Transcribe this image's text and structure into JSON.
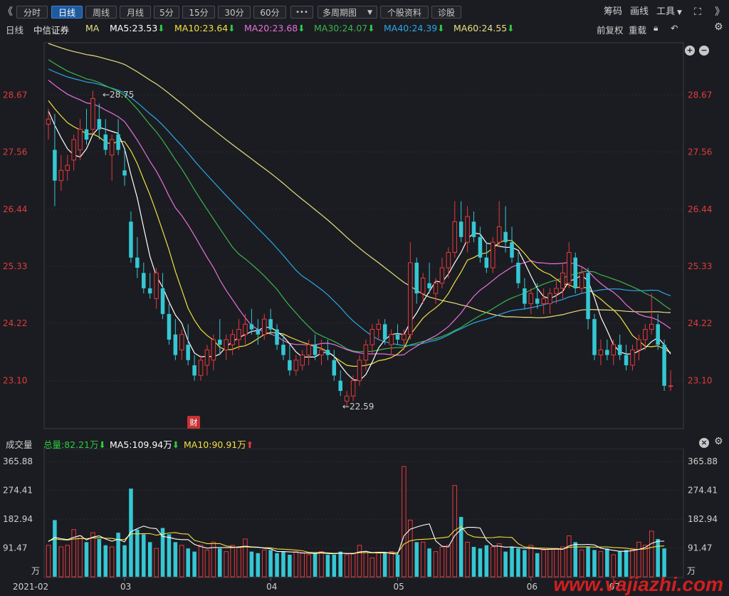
{
  "toolbar": {
    "prev": "《",
    "next": "》",
    "periods": [
      "分时",
      "日线",
      "周线",
      "月线",
      "5分",
      "15分",
      "30分",
      "60分"
    ],
    "active": "日线",
    "more": "•••",
    "multi_period": "多周期图",
    "stock_info": "个股资料",
    "diagnose": "诊股",
    "chips": "筹码",
    "draw": "画线",
    "tools": "工具"
  },
  "legend": {
    "period": "日线",
    "stock": "中信证券",
    "ma": "MA",
    "ma5": "MA5:23.53",
    "ma10": "MA10:23.64",
    "ma20": "MA20:23.68",
    "ma30": "MA30:24.07",
    "ma40": "MA40:24.39",
    "ma60": "MA60:24.55",
    "fq": "前复权",
    "reload": "重载"
  },
  "colors": {
    "up": "#e8383d",
    "down": "#35c7d4",
    "ma5": "#ffffff",
    "ma10": "#f0e040",
    "ma20": "#e870e0",
    "ma30": "#3cb44b",
    "ma40": "#2aa7e8",
    "ma60": "#e8e080",
    "price_axis": "#e03c3c"
  },
  "annotations": {
    "high": "←28.75",
    "low": "←22.59",
    "fin": "财"
  },
  "volume": {
    "title": "成交量",
    "total": "总量:82.21万",
    "ma5": "MA5:109.94万",
    "ma10": "MA10:90.91万",
    "unit": "万"
  },
  "watermark": "www.vajiazhi.com",
  "chart_data": {
    "type": "candlestick",
    "price_ticks": [
      "28.67",
      "27.56",
      "26.44",
      "25.33",
      "24.22",
      "23.10"
    ],
    "volume_ticks": [
      "365.88",
      "274.41",
      "182.94",
      "91.47"
    ],
    "x_ticks": [
      "2021-02",
      "03",
      "04",
      "05",
      "06",
      "07"
    ],
    "ohlc": [
      [
        28.1,
        28.4,
        27.8,
        28.2
      ],
      [
        27.6,
        28.3,
        26.5,
        27.0
      ],
      [
        27.0,
        27.5,
        26.8,
        27.2
      ],
      [
        27.2,
        27.5,
        27.0,
        27.3
      ],
      [
        27.4,
        27.9,
        27.2,
        27.8
      ],
      [
        27.6,
        28.2,
        27.4,
        28.0
      ],
      [
        28.0,
        28.4,
        27.7,
        27.8
      ],
      [
        28.0,
        28.75,
        27.9,
        28.6
      ],
      [
        28.2,
        28.5,
        27.8,
        28.0
      ],
      [
        27.9,
        28.2,
        27.5,
        27.6
      ],
      [
        27.5,
        27.9,
        27.0,
        27.8
      ],
      [
        27.9,
        28.2,
        27.5,
        27.6
      ],
      [
        27.2,
        27.6,
        26.9,
        27.1
      ],
      [
        26.2,
        26.4,
        25.4,
        25.5
      ],
      [
        25.5,
        25.9,
        25.1,
        25.3
      ],
      [
        25.2,
        25.4,
        24.8,
        24.9
      ],
      [
        24.9,
        25.2,
        24.7,
        24.8
      ],
      [
        24.7,
        25.3,
        24.5,
        25.2
      ],
      [
        24.9,
        25.2,
        24.3,
        24.4
      ],
      [
        24.4,
        24.6,
        23.8,
        23.9
      ],
      [
        24.0,
        24.3,
        23.5,
        23.6
      ],
      [
        23.7,
        24.1,
        23.5,
        24.0
      ],
      [
        23.8,
        24.2,
        23.4,
        23.5
      ],
      [
        23.4,
        23.6,
        23.1,
        23.2
      ],
      [
        23.2,
        23.6,
        23.1,
        23.5
      ],
      [
        23.4,
        23.8,
        23.2,
        23.7
      ],
      [
        23.5,
        24.0,
        23.3,
        23.9
      ],
      [
        23.9,
        24.3,
        23.6,
        23.8
      ],
      [
        23.7,
        24.0,
        23.5,
        23.9
      ],
      [
        23.8,
        24.1,
        23.6,
        24.0
      ],
      [
        23.9,
        24.3,
        23.7,
        24.1
      ],
      [
        24.0,
        24.4,
        23.8,
        24.2
      ],
      [
        24.2,
        24.5,
        24.0,
        24.1
      ],
      [
        24.1,
        24.3,
        23.8,
        24.0
      ],
      [
        24.0,
        24.4,
        23.9,
        24.3
      ],
      [
        24.3,
        24.5,
        24.0,
        24.1
      ],
      [
        24.1,
        24.2,
        23.7,
        23.8
      ],
      [
        23.8,
        24.0,
        23.5,
        23.6
      ],
      [
        23.5,
        23.8,
        23.2,
        23.3
      ],
      [
        23.3,
        23.6,
        23.2,
        23.5
      ],
      [
        23.4,
        23.7,
        23.3,
        23.6
      ],
      [
        23.6,
        23.9,
        23.4,
        23.8
      ],
      [
        23.8,
        24.0,
        23.5,
        23.6
      ],
      [
        23.6,
        23.9,
        23.4,
        23.7
      ],
      [
        23.7,
        23.9,
        23.5,
        23.6
      ],
      [
        23.5,
        23.7,
        23.1,
        23.2
      ],
      [
        23.1,
        23.3,
        22.8,
        22.9
      ],
      [
        22.7,
        22.9,
        22.59,
        22.8
      ],
      [
        22.8,
        23.2,
        22.7,
        23.1
      ],
      [
        23.1,
        23.6,
        23.0,
        23.5
      ],
      [
        23.5,
        23.9,
        23.3,
        23.8
      ],
      [
        23.8,
        24.2,
        23.6,
        24.1
      ],
      [
        24.1,
        24.3,
        23.9,
        24.2
      ],
      [
        24.2,
        24.3,
        23.8,
        23.9
      ],
      [
        23.8,
        24.1,
        23.6,
        24.0
      ],
      [
        24.0,
        24.2,
        23.8,
        23.9
      ],
      [
        23.9,
        24.1,
        23.7,
        24.0
      ],
      [
        24.0,
        25.8,
        23.9,
        25.4
      ],
      [
        25.4,
        25.5,
        24.6,
        24.8
      ],
      [
        24.8,
        25.2,
        24.6,
        25.1
      ],
      [
        25.0,
        25.4,
        24.8,
        24.9
      ],
      [
        24.8,
        25.1,
        24.6,
        25.0
      ],
      [
        25.0,
        25.5,
        24.9,
        25.3
      ],
      [
        25.3,
        25.7,
        25.1,
        25.6
      ],
      [
        25.6,
        26.6,
        25.5,
        26.2
      ],
      [
        26.2,
        26.6,
        25.8,
        25.9
      ],
      [
        25.8,
        26.5,
        25.6,
        26.3
      ],
      [
        26.2,
        26.4,
        25.8,
        25.9
      ],
      [
        25.9,
        26.1,
        25.4,
        25.5
      ],
      [
        25.5,
        25.8,
        25.2,
        25.3
      ],
      [
        25.3,
        25.9,
        25.2,
        25.8
      ],
      [
        25.8,
        26.6,
        25.7,
        26.1
      ],
      [
        26.0,
        26.5,
        25.6,
        25.8
      ],
      [
        25.8,
        26.1,
        25.4,
        25.5
      ],
      [
        25.4,
        25.6,
        24.9,
        25.0
      ],
      [
        24.9,
        25.1,
        24.5,
        24.6
      ],
      [
        24.6,
        24.9,
        24.4,
        24.8
      ],
      [
        24.7,
        25.0,
        24.5,
        24.6
      ],
      [
        24.6,
        24.9,
        24.4,
        24.7
      ],
      [
        24.6,
        24.9,
        24.4,
        24.8
      ],
      [
        24.8,
        25.1,
        24.6,
        24.9
      ],
      [
        24.9,
        25.4,
        24.7,
        25.2
      ],
      [
        25.0,
        25.8,
        24.9,
        25.6
      ],
      [
        25.5,
        25.6,
        24.8,
        24.9
      ],
      [
        24.9,
        25.3,
        24.8,
        25.2
      ],
      [
        25.2,
        25.3,
        24.1,
        24.3
      ],
      [
        24.3,
        24.4,
        23.5,
        23.6
      ],
      [
        23.6,
        23.9,
        23.4,
        23.7
      ],
      [
        23.7,
        23.9,
        23.5,
        23.6
      ],
      [
        23.6,
        23.9,
        23.4,
        23.8
      ],
      [
        23.8,
        24.0,
        23.5,
        23.6
      ],
      [
        23.6,
        23.8,
        23.3,
        23.4
      ],
      [
        23.4,
        23.8,
        23.3,
        23.7
      ],
      [
        23.7,
        24.0,
        23.5,
        23.9
      ],
      [
        23.9,
        24.2,
        23.7,
        24.1
      ],
      [
        24.1,
        24.8,
        24.0,
        24.2
      ],
      [
        24.2,
        24.4,
        23.7,
        23.8
      ],
      [
        23.8,
        23.9,
        22.9,
        23.0
      ],
      [
        23.0,
        23.3,
        22.9,
        23.0
      ]
    ],
    "volume": [
      100,
      180,
      95,
      100,
      150,
      130,
      110,
      140,
      120,
      100,
      95,
      140,
      100,
      280,
      150,
      135,
      110,
      90,
      155,
      135,
      110,
      100,
      90,
      80,
      100,
      85,
      110,
      90,
      80,
      100,
      95,
      120,
      80,
      75,
      85,
      85,
      75,
      80,
      70,
      80,
      75,
      70,
      75,
      80,
      70,
      70,
      80,
      70,
      75,
      100,
      80,
      60,
      75,
      75,
      80,
      70,
      350,
      180,
      110,
      110,
      90,
      80,
      95,
      100,
      290,
      190,
      110,
      95,
      90,
      100,
      95,
      105,
      80,
      95,
      90,
      85,
      100,
      75,
      85,
      90,
      90,
      95,
      130,
      110,
      85,
      95,
      85,
      80,
      90,
      70,
      80,
      85,
      90,
      110,
      100,
      145,
      120,
      90
    ]
  }
}
